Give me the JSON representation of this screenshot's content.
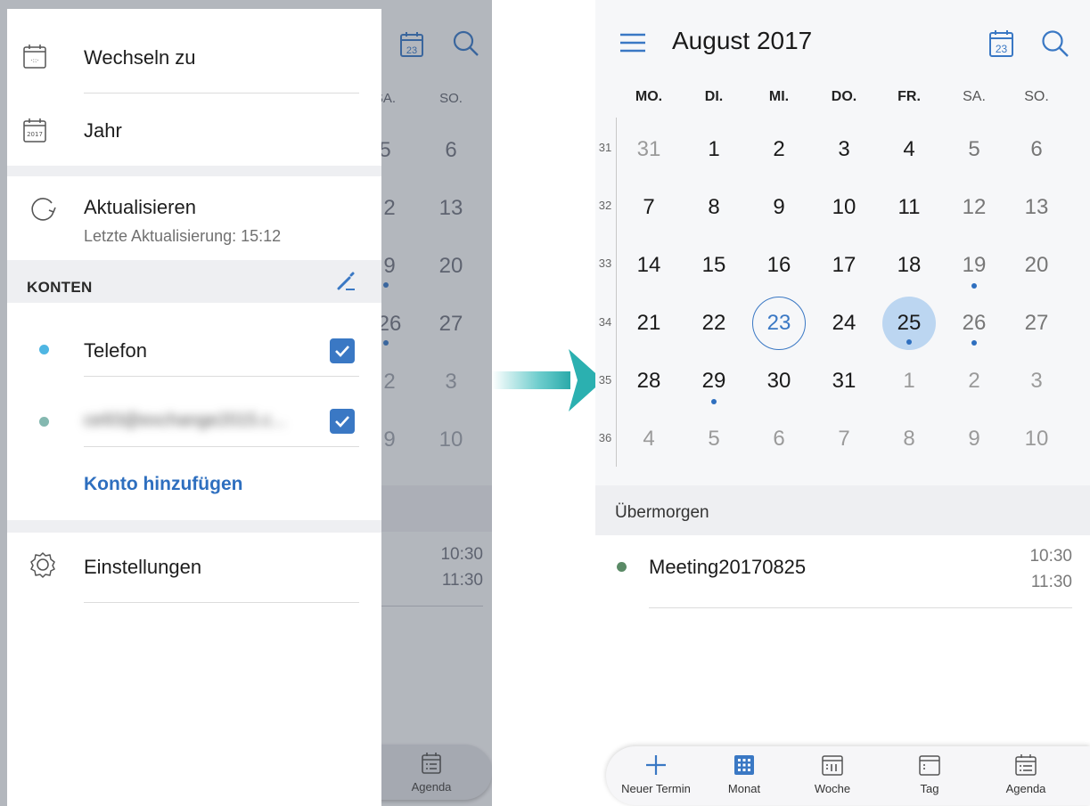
{
  "left_phone": {
    "background": {
      "dow": [
        "SA.",
        "SO."
      ],
      "rows": [
        [
          "5",
          "6"
        ],
        [
          "2",
          "13"
        ],
        [
          "9",
          "20"
        ],
        [
          "26",
          "27"
        ],
        [
          "2",
          "3"
        ],
        [
          "9",
          "10"
        ]
      ],
      "times": [
        "10:30",
        "11:30"
      ],
      "agenda_label": "Agenda"
    },
    "drawer": {
      "switch_to": "Wechseln zu",
      "year": "Jahr",
      "year_icon_text": "2017",
      "refresh": "Aktualisieren",
      "last_refresh": "Letzte Aktualisierung: 15:12",
      "accounts_title": "KONTEN",
      "accounts": [
        {
          "name": "Telefon",
          "checked": true,
          "dot_color": "#4fb6e3"
        },
        {
          "name": "ce93@exchange2015.c...",
          "checked": true,
          "dot_color": "#84b8b0",
          "obscured": true
        }
      ],
      "add_account": "Konto hinzufügen",
      "settings": "Einstellungen"
    }
  },
  "right_phone": {
    "header": {
      "title": "August 2017",
      "today_icon_text": "23"
    },
    "days_of_week": [
      "MO.",
      "DI.",
      "MI.",
      "DO.",
      "FR.",
      "SA.",
      "SO."
    ],
    "weeks": [
      {
        "num": "31",
        "days": [
          "31",
          "1",
          "2",
          "3",
          "4",
          "5",
          "6"
        ]
      },
      {
        "num": "32",
        "days": [
          "7",
          "8",
          "9",
          "10",
          "11",
          "12",
          "13"
        ]
      },
      {
        "num": "33",
        "days": [
          "14",
          "15",
          "16",
          "17",
          "18",
          "19",
          "20"
        ]
      },
      {
        "num": "34",
        "days": [
          "21",
          "22",
          "23",
          "24",
          "25",
          "26",
          "27"
        ]
      },
      {
        "num": "35",
        "days": [
          "28",
          "29",
          "30",
          "31",
          "1",
          "2",
          "3"
        ]
      },
      {
        "num": "36",
        "days": [
          "4",
          "5",
          "6",
          "7",
          "8",
          "9",
          "10"
        ]
      }
    ],
    "today": "23",
    "selected": "25",
    "agenda_heading": "Übermorgen",
    "event": {
      "title": "Meeting20170825",
      "start": "10:30",
      "end": "11:30"
    },
    "bottom_nav": [
      "Neuer Termin",
      "Monat",
      "Woche",
      "Tag",
      "Agenda"
    ]
  },
  "colors": {
    "accent": "#3a78c4",
    "link": "#2e6fbf",
    "arrow": "#2fb7b7"
  }
}
